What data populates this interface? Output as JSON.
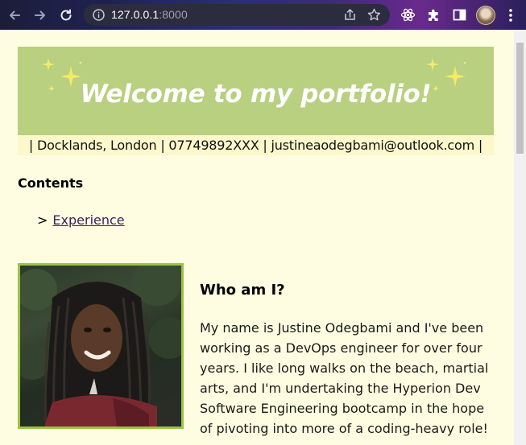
{
  "browser": {
    "url_host": "127.0.0.1",
    "url_port": ":8000",
    "icons": {
      "back": "arrow-left-icon",
      "forward": "arrow-right-icon",
      "reload": "reload-icon",
      "site_info": "info-icon",
      "share": "share-icon",
      "bookmark": "star-icon",
      "react_devtools": "react-icon",
      "extensions": "puzzle-icon",
      "side_panel": "side-panel-icon",
      "profile": "avatar",
      "menu": "kebab-menu-icon"
    }
  },
  "banner": {
    "title": "Welcome to my portfolio!",
    "background": "#b8d07f",
    "sparkle_color": "#f5e96b"
  },
  "contact": {
    "text": "| Docklands, London | 07749892XXX | justineaodegbami@outlook.com |"
  },
  "contents": {
    "heading": "Contents",
    "items": [
      {
        "marker": ">",
        "label": "Experience"
      }
    ]
  },
  "about": {
    "heading": "Who am I?",
    "text": "My name is Justine Odegbami and I've been working as a DevOps engineer for over four years. I like long walks on the beach, martial arts, and I'm undertaking the Hyperion Dev Software Engineering bootcamp in the hope of pivoting into more of a coding-heavy role!"
  },
  "colors": {
    "page_background": "#fffde1",
    "contact_background": "#fbf8cc",
    "photo_border": "#9bc24a"
  }
}
